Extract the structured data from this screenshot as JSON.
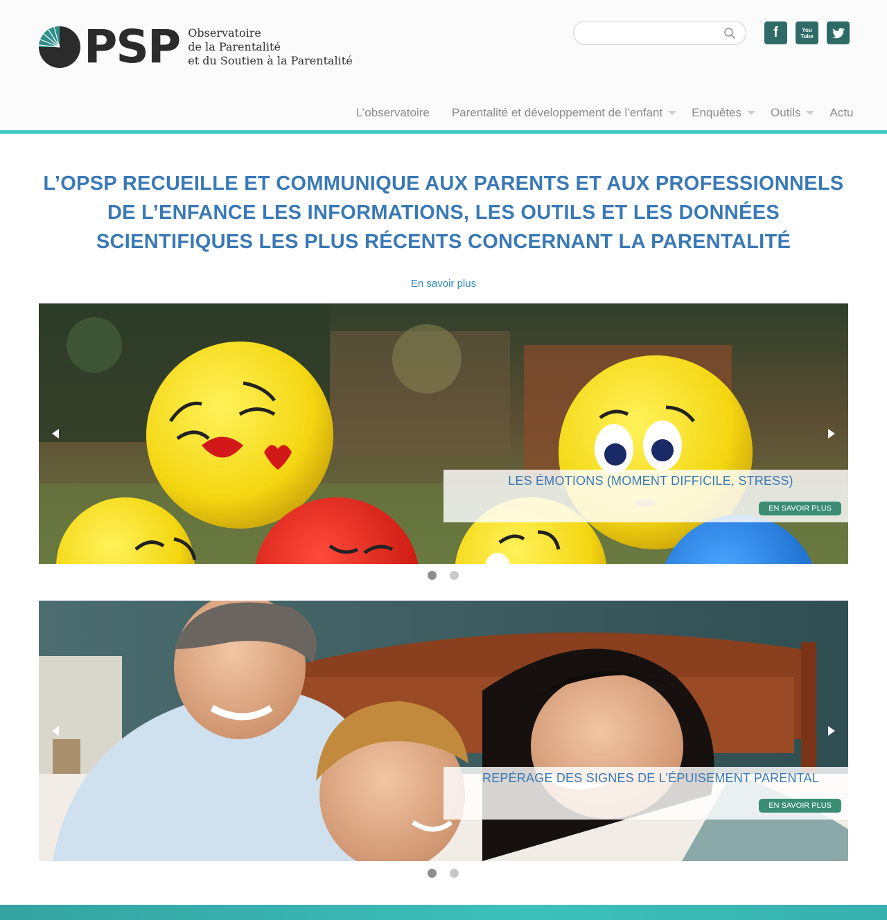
{
  "header": {
    "logo_letters": "PSP",
    "logo_line1": "Observatoire",
    "logo_line2": "de la Parentalité",
    "logo_line3": "et du Soutien à la Parentalité",
    "search_placeholder": "",
    "social": {
      "facebook_label": "f",
      "youtube_line1": "You",
      "youtube_line2": "Tube"
    }
  },
  "nav": {
    "items": [
      {
        "label": "L’observatoire",
        "has_dropdown": false
      },
      {
        "label": "Parentalité et développement de l’enfant",
        "has_dropdown": true
      },
      {
        "label": "Enquêtes",
        "has_dropdown": true
      },
      {
        "label": "Outils",
        "has_dropdown": true
      },
      {
        "label": "Actu",
        "has_dropdown": false
      }
    ]
  },
  "tagline": {
    "line1": "L’OPSP RECUEILLE ET COMMUNIQUE AUX PARENTS ET AUX PROFESSIONNELS",
    "line2": "DE L’ENFANCE LES INFORMATIONS, LES OUTILS ET LES DONNÉES",
    "line3": "SCIENTIFIQUES LES PLUS RÉCENTS CONCERNANT LA PARENTALITÉ",
    "more_link": "En savoir plus"
  },
  "sliders": [
    {
      "caption": "LES ÉMOTIONS (MOMENT DIFFICILE, STRESS)",
      "button": "EN SAVOIR PLUS",
      "active_dot": 1,
      "dot_count": 2
    },
    {
      "caption": "REPÉRAGE DES SIGNES DE L’ÉPUISEMENT PARENTAL",
      "button": "EN SAVOIR PLUS",
      "active_dot": 1,
      "dot_count": 2
    }
  ],
  "colors": {
    "accent_teal": "#3ec9c4",
    "social_bg": "#2e6b67",
    "heading_blue": "#3a79b5",
    "button_green": "#3a8d72"
  },
  "icons": {
    "search": "search-icon",
    "facebook": "facebook-icon",
    "youtube": "youtube-icon",
    "twitter": "twitter-icon",
    "prev": "arrow-left-icon",
    "next": "arrow-right-icon"
  }
}
